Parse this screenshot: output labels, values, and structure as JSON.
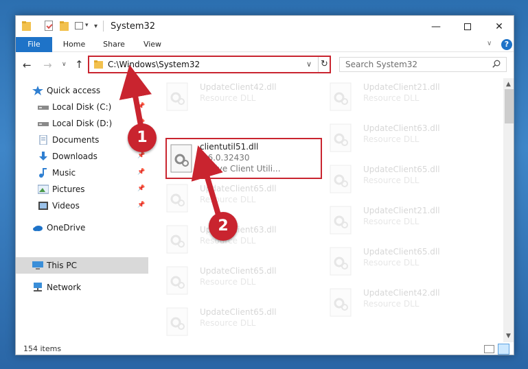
{
  "window": {
    "title": "System32",
    "controls": {
      "minimize": "—",
      "maximize": "",
      "close": "✕"
    }
  },
  "ribbon": {
    "tabs": [
      {
        "label": "File",
        "active": true
      },
      {
        "label": "Home"
      },
      {
        "label": "Share"
      },
      {
        "label": "View"
      }
    ],
    "help": "?"
  },
  "address": {
    "path": "C:\\Windows\\System32",
    "search_placeholder": "Search System32"
  },
  "sidebar": {
    "items": [
      {
        "label": "Quick access",
        "icon": "star-icon"
      },
      {
        "label": "Local Disk (C:)",
        "icon": "drive-icon",
        "pinned": true
      },
      {
        "label": "Local Disk (D:)",
        "icon": "drive-icon",
        "pinned": true
      },
      {
        "label": "Documents",
        "icon": "documents-icon",
        "pinned": true
      },
      {
        "label": "Downloads",
        "icon": "downloads-icon",
        "pinned": true
      },
      {
        "label": "Music",
        "icon": "music-icon",
        "pinned": true
      },
      {
        "label": "Pictures",
        "icon": "pictures-icon",
        "pinned": true
      },
      {
        "label": "Videos",
        "icon": "videos-icon",
        "pinned": true
      },
      {
        "label": "OneDrive",
        "icon": "onedrive-icon"
      },
      {
        "label": "This PC",
        "icon": "computer-icon",
        "selected": true
      },
      {
        "label": "Network",
        "icon": "network-icon"
      }
    ]
  },
  "files": {
    "column1": [
      {
        "name": "UpdateClient42.dll",
        "desc": "Resource DLL",
        "faded": true
      },
      {
        "name": "clientutil51.dll",
        "desc": "1.6.0.32430",
        "desc2": "Motive Client Utili...",
        "highlighted": true
      },
      {
        "name": "UpdateClient65.dll",
        "desc": "Resource DLL",
        "faded": true
      },
      {
        "name": "UpdateClient63.dll",
        "desc": "Resource DLL",
        "faded": true
      },
      {
        "name": "UpdateClient65.dll",
        "desc": "Resource DLL",
        "faded": true
      },
      {
        "name": "UpdateClient65.dll",
        "desc": "Resource DLL",
        "faded": true
      }
    ],
    "column2": [
      {
        "name": "UpdateClient21.dll",
        "desc": "Resource DLL",
        "faded": true
      },
      {
        "name": "UpdateClient63.dll",
        "desc": "Resource DLL",
        "faded": true
      },
      {
        "name": "UpdateClient65.dll",
        "desc": "Resource DLL",
        "faded": true
      },
      {
        "name": "UpdateClient21.dll",
        "desc": "Resource DLL",
        "faded": true
      },
      {
        "name": "UpdateClient65.dll",
        "desc": "Resource DLL",
        "faded": true
      },
      {
        "name": "UpdateClient42.dll",
        "desc": "Resource DLL",
        "faded": true
      }
    ]
  },
  "status": {
    "item_count": "154 items"
  },
  "annotations": {
    "badge1": "1",
    "badge2": "2",
    "color": "#c9242f"
  },
  "colors": {
    "accent": "#1e73c8",
    "highlight": "#c9242f",
    "selected": "#d9d9d9"
  }
}
